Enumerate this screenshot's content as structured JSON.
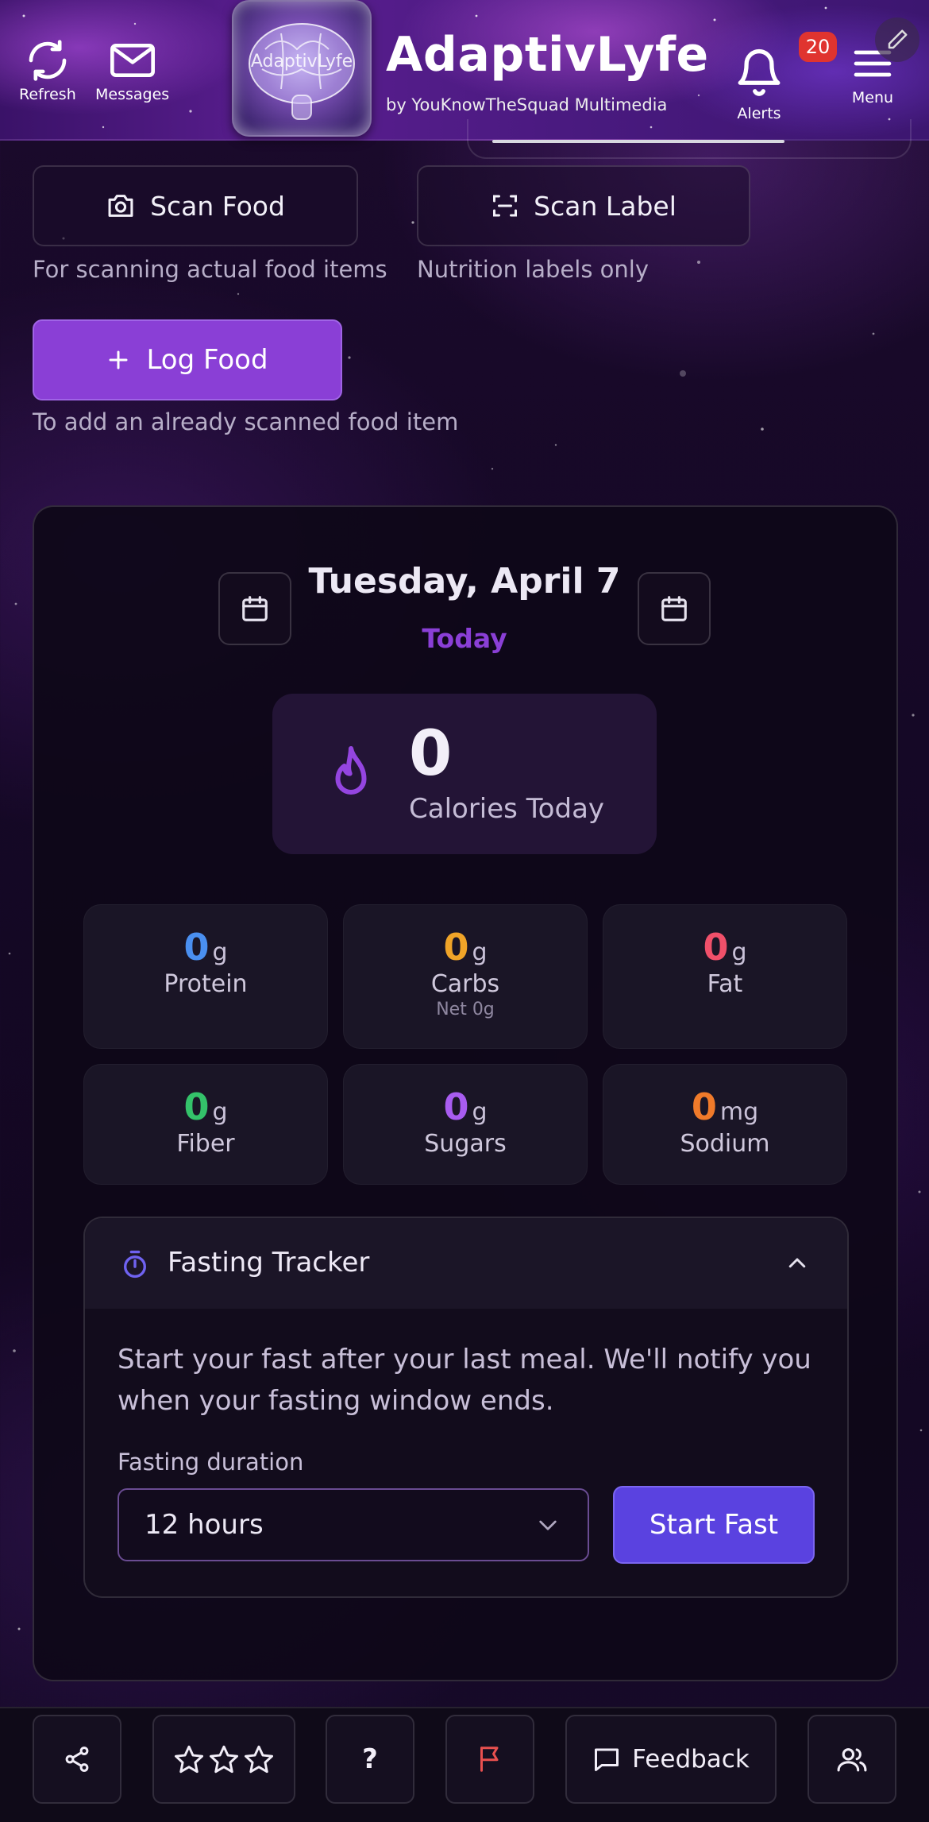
{
  "header": {
    "refresh_label": "Refresh",
    "messages_label": "Messages",
    "logo_text": "AdaptivLyfe",
    "app_title": "AdaptivLyfe",
    "app_subtitle": "by YouKnowTheSquad Multimedia",
    "alerts_label": "Alerts",
    "alerts_count": "20",
    "menu_label": "Menu"
  },
  "actions": {
    "scan_food_label": "Scan Food",
    "scan_food_hint": "For scanning actual food items",
    "scan_label_label": "Scan Label",
    "scan_label_hint": "Nutrition labels only",
    "log_food_label": "Log Food",
    "log_food_hint": "To add an already scanned food item"
  },
  "day": {
    "date": "Tuesday, April 7",
    "relative": "Today"
  },
  "calories": {
    "value": "0",
    "label": "Calories Today"
  },
  "nutrients": [
    {
      "value": "0",
      "unit": "g",
      "name": "Protein",
      "color": "#4a8ff0"
    },
    {
      "value": "0",
      "unit": "g",
      "name": "Carbs",
      "sub": "Net 0g",
      "color": "#f0a428"
    },
    {
      "value": "0",
      "unit": "g",
      "name": "Fat",
      "color": "#f0506a"
    },
    {
      "value": "0",
      "unit": "g",
      "name": "Fiber",
      "color": "#34c26a"
    },
    {
      "value": "0",
      "unit": "g",
      "name": "Sugars",
      "color": "#a85cf0"
    },
    {
      "value": "0",
      "unit": "mg",
      "name": "Sodium",
      "color": "#f07a2a"
    }
  ],
  "fasting": {
    "title": "Fasting Tracker",
    "description": "Start your fast after your last meal. We'll notify you when your fasting window ends.",
    "duration_label": "Fasting duration",
    "duration_value": "12 hours",
    "start_label": "Start Fast"
  },
  "bottom_bar": {
    "help_label": "?",
    "feedback_label": "Feedback"
  },
  "colors": {
    "accent": "#8a3fd6",
    "primary_button": "#5a42e0",
    "badge": "#e0342f"
  }
}
